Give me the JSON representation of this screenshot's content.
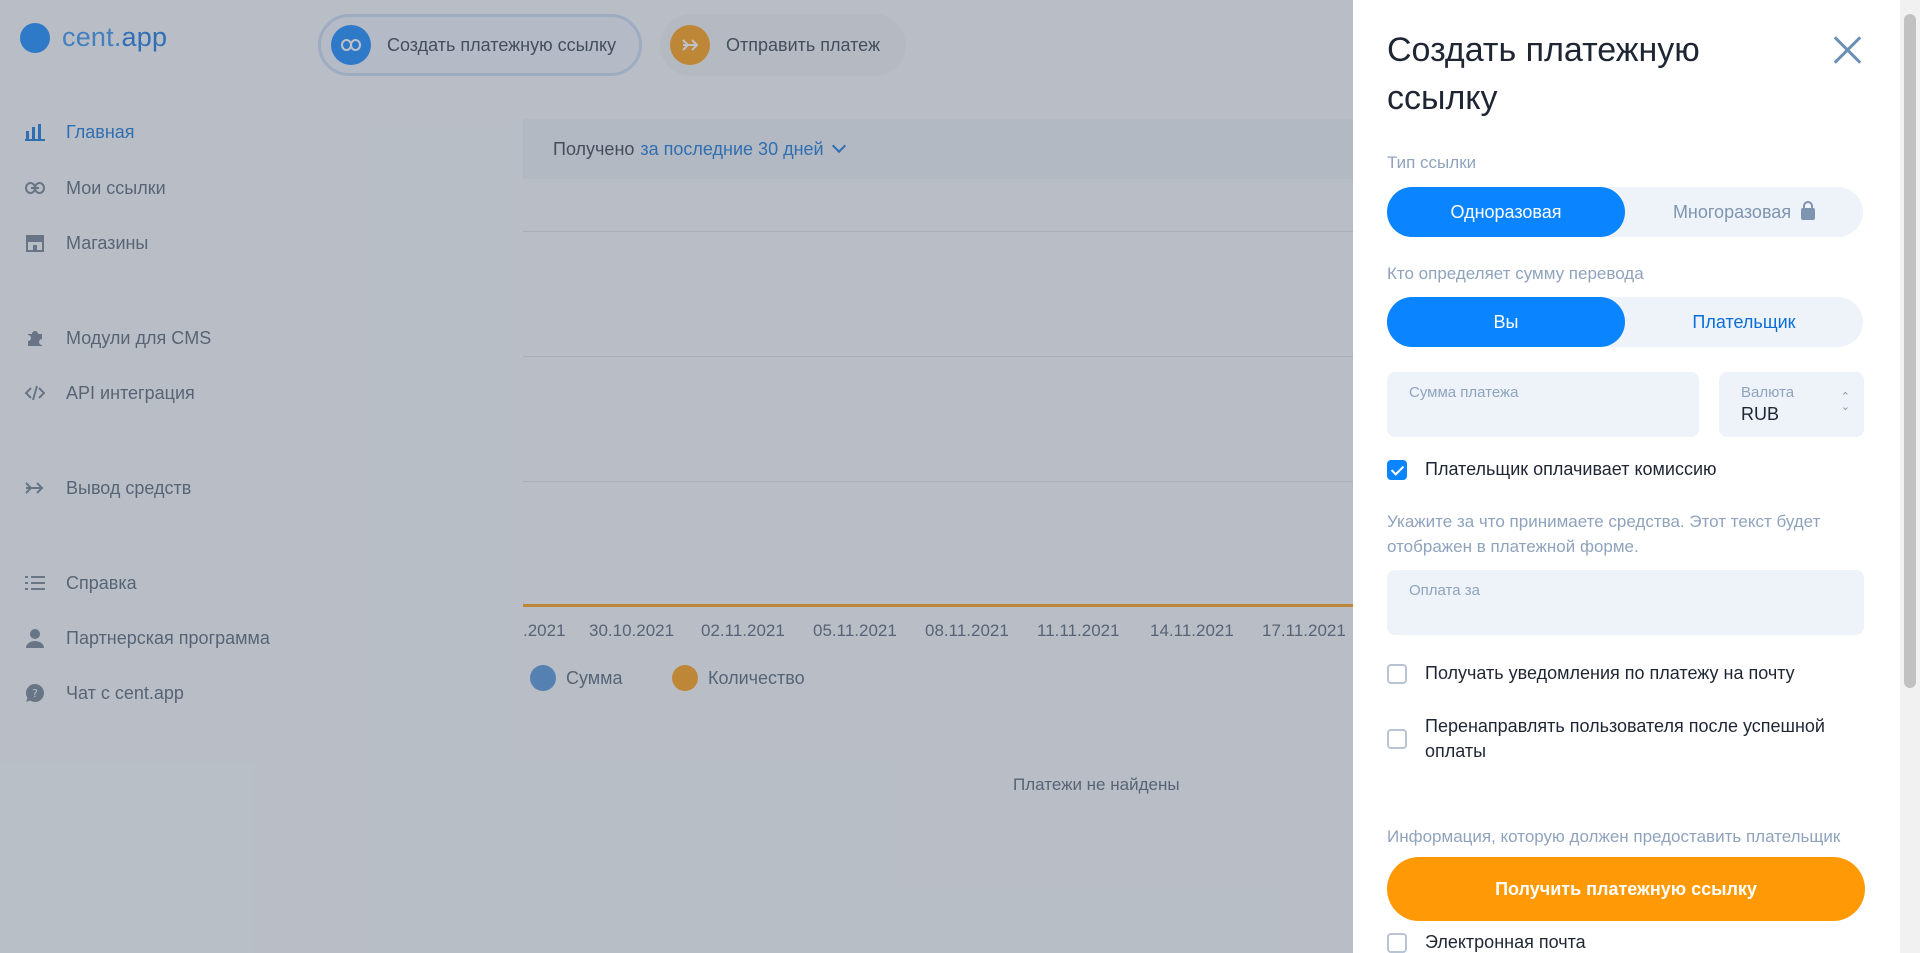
{
  "app": {
    "logo_plain": "cent.",
    "logo_accent": "app"
  },
  "sidebar": {
    "items": [
      {
        "label": "Главная",
        "icon": "chart-icon"
      },
      {
        "label": "Мои ссылки",
        "icon": "link-icon"
      },
      {
        "label": "Магазины",
        "icon": "store-icon"
      },
      {
        "label": "Модули для CMS",
        "icon": "puzzle-icon"
      },
      {
        "label": "API интеграция",
        "icon": "code-icon"
      },
      {
        "label": "Вывод средств",
        "icon": "arrow-right-icon"
      },
      {
        "label": "Справка",
        "icon": "list-icon"
      },
      {
        "label": "Партнерская программа",
        "icon": "user-icon"
      },
      {
        "label": "Чат с cent.app",
        "icon": "chat-question-icon"
      }
    ]
  },
  "topbar": {
    "create_link": "Создать платежную ссылку",
    "send_payment": "Отправить платеж"
  },
  "main": {
    "received_label": "Получено",
    "period": "за последние 30 дней",
    "empty_message": "Платежи не найдены"
  },
  "chart_data": {
    "type": "line",
    "x": [
      ".2021",
      "30.10.2021",
      "02.11.2021",
      "05.11.2021",
      "08.11.2021",
      "11.11.2021",
      "14.11.2021",
      "17.11.2021"
    ],
    "series": [
      {
        "name": "Сумма",
        "color": "#4a90d9",
        "values": [
          0,
          0,
          0,
          0,
          0,
          0,
          0,
          0
        ]
      },
      {
        "name": "Количество",
        "color": "#ff9a06",
        "values": [
          0,
          0,
          0,
          0,
          0,
          0,
          0,
          0
        ]
      }
    ],
    "grid": true,
    "legend": "bottom-left"
  },
  "drawer": {
    "title": "Создать платежную ссылку",
    "link_type_label": "Тип ссылки",
    "link_type_options": [
      "Одноразовая",
      "Многоразовая"
    ],
    "amount_owner_label": "Кто определяет сумму перевода",
    "amount_owner_options": [
      "Вы",
      "Плательщик"
    ],
    "amount_label": "Сумма платежа",
    "amount_value": "",
    "currency_label": "Валюта",
    "currency_value": "RUB",
    "fee_checkbox": "Плательщик оплачивает комиссию",
    "fee_checked": true,
    "purpose_hint": "Укажите за что принимаете средства. Этот текст будет отображен в платежной форме.",
    "purpose_label": "Оплата за",
    "notify_checkbox": "Получать уведомления по платежу на почту",
    "redirect_checkbox": "Перенаправлять пользователя после успешной оплаты",
    "payer_info_hint": "Информация, которую должен предоставить плательщик",
    "submit_button": "Получить платежную ссылку",
    "email_checkbox": "Электронная почта"
  },
  "colors": {
    "accent": "#0a84ff",
    "orange": "#ff9a06"
  }
}
